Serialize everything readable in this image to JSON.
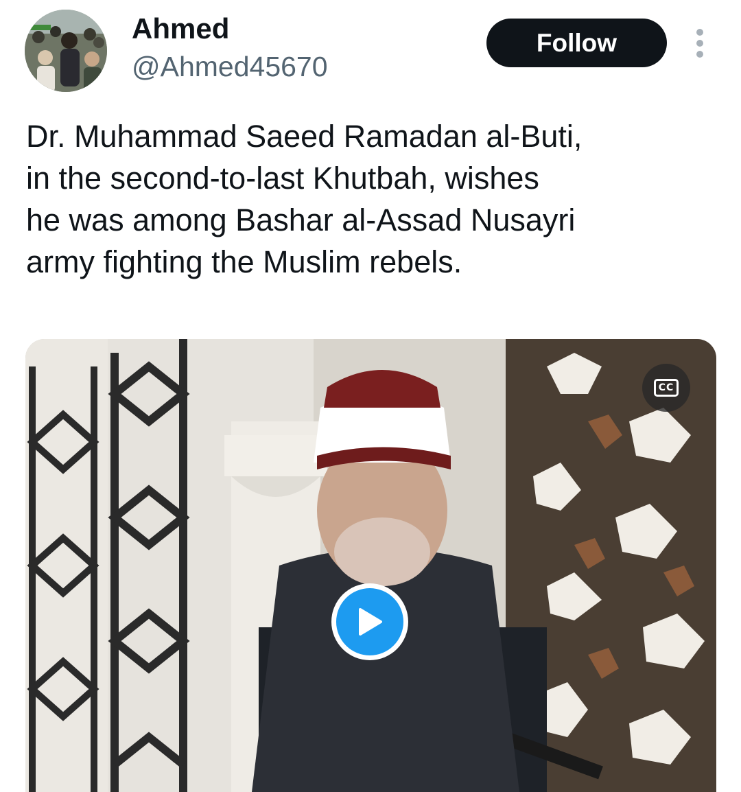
{
  "author": {
    "display_name": "Ahmed",
    "handle": "@Ahmed45670",
    "avatar_icon": "profile-photo-crowd"
  },
  "actions": {
    "follow_label": "Follow",
    "more_icon": "more-vertical-icon"
  },
  "tweet": {
    "lines": [
      "Dr. Muhammad Saeed Ramadan al-Buti,",
      "in the second-to-last Khutbah, wishes",
      "he was among Bashar al-Assad Nusayri",
      "army fighting the Muslim rebels."
    ]
  },
  "media": {
    "type": "video",
    "cc_label": "CC",
    "play_icon": "play-icon"
  },
  "colors": {
    "accent": "#1d9bf0",
    "text_primary": "#0f1419",
    "text_secondary": "#536471",
    "button_dark": "#0f1419"
  }
}
